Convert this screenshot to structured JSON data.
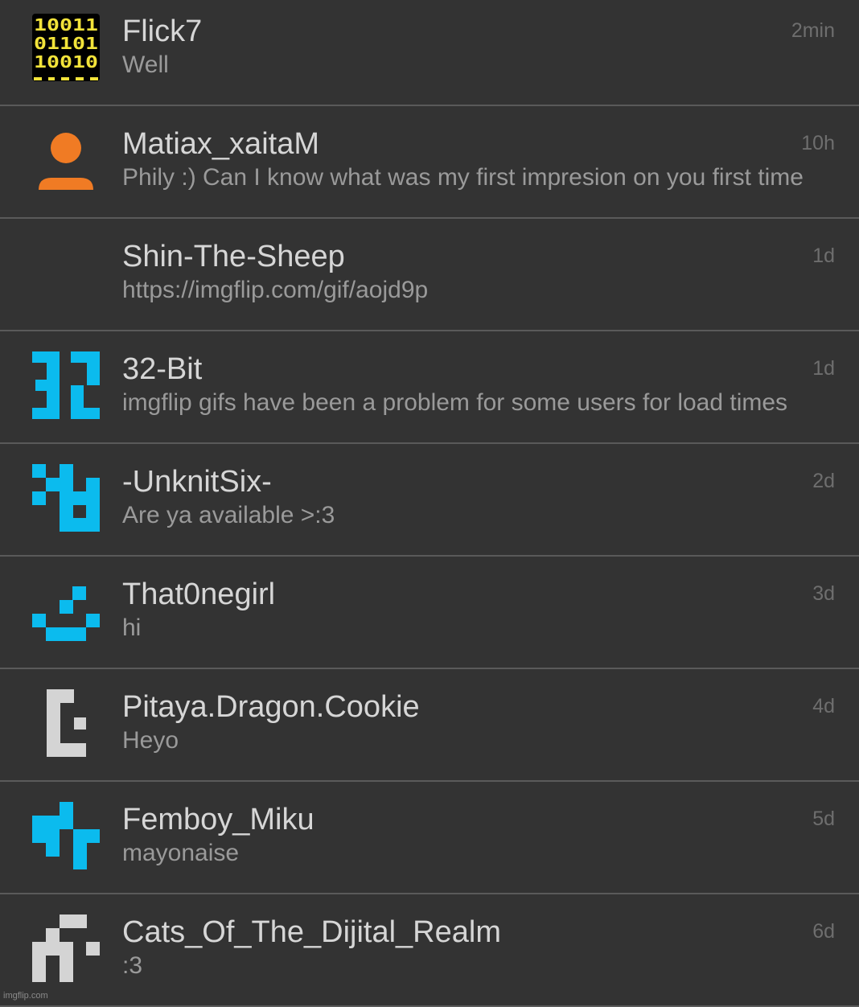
{
  "conversations": [
    {
      "username": "Flick7",
      "preview": "Well",
      "time": "2min",
      "avatar": "binary-code-icon"
    },
    {
      "username": "Matiax_xaitaM",
      "preview": "Phily :) Can I know what was my first impresion on you first time",
      "time": "10h",
      "avatar": "default-user-icon"
    },
    {
      "username": "Shin-The-Sheep",
      "preview": "https://imgflip.com/gif/aojd9p",
      "time": "1d",
      "avatar": "blank-avatar"
    },
    {
      "username": "32-Bit",
      "preview": "imgflip gifs have been a problem for some users for load times",
      "time": "1d",
      "avatar": "pixel-32-icon"
    },
    {
      "username": "-UnknitSix-",
      "preview": "Are ya available >:3",
      "time": "2d",
      "avatar": "pixel-identicon"
    },
    {
      "username": "That0negirl",
      "preview": "hi",
      "time": "3d",
      "avatar": "pixel-identicon"
    },
    {
      "username": "Pitaya.Dragon.Cookie",
      "preview": "Heyo",
      "time": "4d",
      "avatar": "pixel-identicon"
    },
    {
      "username": "Femboy_Miku",
      "preview": "mayonaise",
      "time": "5d",
      "avatar": "pixel-identicon"
    },
    {
      "username": "Cats_Of_The_Dijital_Realm",
      "preview": ":3",
      "time": "6d",
      "avatar": "pixel-identicon"
    }
  ],
  "watermark": "imgflip.com",
  "colors": {
    "background": "#333333",
    "divider": "#5a5a5a",
    "identicon_blue": "#0bbbee",
    "identicon_gray": "#d4d4d4",
    "user_orange": "#f07b24",
    "binary_yellow": "#f2e33a"
  }
}
